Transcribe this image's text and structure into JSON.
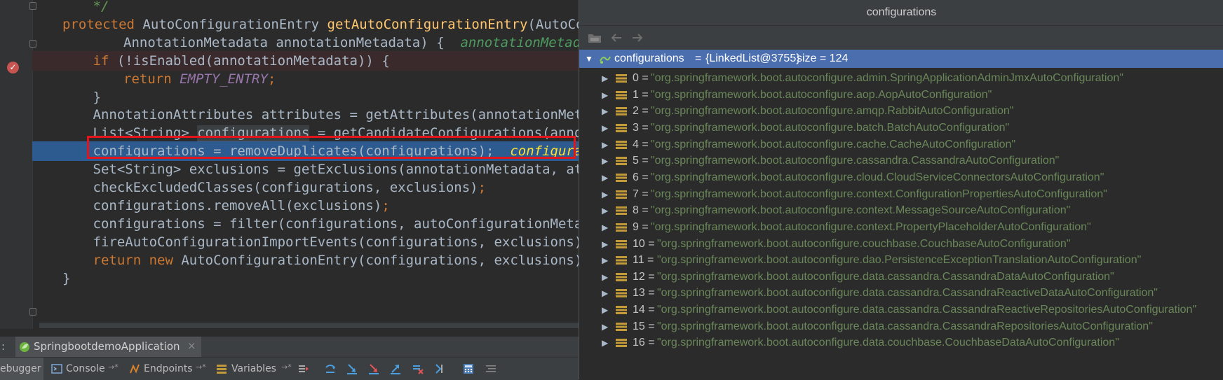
{
  "editor": {
    "lines": [
      {
        "indent": 2,
        "segments": [
          {
            "text": "*/",
            "cls": "cm"
          }
        ]
      },
      {
        "indent": 1,
        "segments": [
          {
            "text": "protected ",
            "cls": "kw"
          },
          {
            "text": "AutoConfigurationEntry ",
            "cls": ""
          },
          {
            "text": "getAutoConfigurationEntry",
            "cls": "fn"
          },
          {
            "text": "(AutoCon",
            "cls": ""
          }
        ]
      },
      {
        "indent": 3,
        "segments": [
          {
            "text": "AnnotationMetadata annotationMetadata) {  ",
            "cls": ""
          },
          {
            "text": "annotationMetadata",
            "cls": "inlay"
          }
        ]
      },
      {
        "indent": 2,
        "segments": [
          {
            "text": "if ",
            "cls": "kw"
          },
          {
            "text": "(!isEnabled(annotationMetadata)) {",
            "cls": ""
          }
        ]
      },
      {
        "indent": 3,
        "segments": [
          {
            "text": "return ",
            "cls": "kw"
          },
          {
            "text": "EMPTY_ENTRY",
            "cls": "const"
          },
          {
            "text": ";",
            "cls": "kw"
          }
        ]
      },
      {
        "indent": 2,
        "segments": [
          {
            "text": "}",
            "cls": ""
          }
        ]
      },
      {
        "indent": 2,
        "segments": [
          {
            "text": "AnnotationAttributes attributes = getAttributes(annotationMeta",
            "cls": ""
          }
        ]
      },
      {
        "indent": 2,
        "segments": [
          {
            "text": "List<String> ",
            "cls": ""
          },
          {
            "text": "configurations",
            "cls": "hl-var"
          },
          {
            "text": " = getCandidateConfigurations(annot",
            "cls": ""
          }
        ]
      },
      {
        "indent": 2,
        "segments": [
          {
            "text": "configurations = removeDuplicates(configurations);  ",
            "cls": ""
          },
          {
            "text": "configurat",
            "cls": "inlay-y"
          }
        ]
      },
      {
        "indent": 2,
        "segments": [
          {
            "text": "Set<String> exclusions = getExclusions(annotationMetadata, att",
            "cls": ""
          }
        ]
      },
      {
        "indent": 2,
        "segments": [
          {
            "text": "checkExcludedClasses(configurations, exclusions)",
            "cls": ""
          },
          {
            "text": ";",
            "cls": "kw"
          }
        ]
      },
      {
        "indent": 2,
        "segments": [
          {
            "text": "configurations.removeAll(exclusions)",
            "cls": ""
          },
          {
            "text": ";",
            "cls": "kw"
          }
        ]
      },
      {
        "indent": 2,
        "segments": [
          {
            "text": "configurations = filter(configurations, autoConfigurationMetad",
            "cls": ""
          }
        ]
      },
      {
        "indent": 2,
        "segments": [
          {
            "text": "fireAutoConfigurationImportEvents(configurations, exclusions)",
            "cls": ""
          },
          {
            "text": ";",
            "cls": "kw"
          }
        ]
      },
      {
        "indent": 2,
        "segments": [
          {
            "text": "return new ",
            "cls": "kw"
          },
          {
            "text": "AutoConfigurationEntry(configurations, exclusions)",
            "cls": ""
          },
          {
            "text": ";",
            "cls": "kw"
          }
        ]
      },
      {
        "indent": 1,
        "segments": [
          {
            "text": "}",
            "cls": ""
          }
        ]
      }
    ]
  },
  "run_tab": {
    "prefix": ":",
    "app_name": "SpringbootdemoApplication",
    "close": "×"
  },
  "debug_toolbar": {
    "debugger_label": "ebugger",
    "console_label": "Console",
    "endpoints_label": "Endpoints",
    "variables_label": "Variables",
    "pin_glyph": "→*"
  },
  "popup": {
    "title": "configurations",
    "root": {
      "name": "configurations",
      "value": "{LinkedList@3755}",
      "size_text": "size = 124"
    },
    "items": [
      {
        "index": "0",
        "value": "\"org.springframework.boot.autoconfigure.admin.SpringApplicationAdminJmxAutoConfiguration\""
      },
      {
        "index": "1",
        "value": "\"org.springframework.boot.autoconfigure.aop.AopAutoConfiguration\""
      },
      {
        "index": "2",
        "value": "\"org.springframework.boot.autoconfigure.amqp.RabbitAutoConfiguration\""
      },
      {
        "index": "3",
        "value": "\"org.springframework.boot.autoconfigure.batch.BatchAutoConfiguration\""
      },
      {
        "index": "4",
        "value": "\"org.springframework.boot.autoconfigure.cache.CacheAutoConfiguration\""
      },
      {
        "index": "5",
        "value": "\"org.springframework.boot.autoconfigure.cassandra.CassandraAutoConfiguration\""
      },
      {
        "index": "6",
        "value": "\"org.springframework.boot.autoconfigure.cloud.CloudServiceConnectorsAutoConfiguration\""
      },
      {
        "index": "7",
        "value": "\"org.springframework.boot.autoconfigure.context.ConfigurationPropertiesAutoConfiguration\""
      },
      {
        "index": "8",
        "value": "\"org.springframework.boot.autoconfigure.context.MessageSourceAutoConfiguration\""
      },
      {
        "index": "9",
        "value": "\"org.springframework.boot.autoconfigure.context.PropertyPlaceholderAutoConfiguration\""
      },
      {
        "index": "10",
        "value": "\"org.springframework.boot.autoconfigure.couchbase.CouchbaseAutoConfiguration\""
      },
      {
        "index": "11",
        "value": "\"org.springframework.boot.autoconfigure.dao.PersistenceExceptionTranslationAutoConfiguration\""
      },
      {
        "index": "12",
        "value": "\"org.springframework.boot.autoconfigure.data.cassandra.CassandraDataAutoConfiguration\""
      },
      {
        "index": "13",
        "value": "\"org.springframework.boot.autoconfigure.data.cassandra.CassandraReactiveDataAutoConfiguration\""
      },
      {
        "index": "14",
        "value": "\"org.springframework.boot.autoconfigure.data.cassandra.CassandraReactiveRepositoriesAutoConfiguration\""
      },
      {
        "index": "15",
        "value": "\"org.springframework.boot.autoconfigure.data.cassandra.CassandraRepositoriesAutoConfiguration\""
      },
      {
        "index": "16",
        "value": "\"org.springframework.boot.autoconfigure.data.couchbase.CouchbaseDataAutoConfiguration\""
      }
    ]
  },
  "colors": {
    "editor_bg": "#2b2b2b",
    "exec_line": "#2d5b8f",
    "breakpoint_line": "#3b2a2b",
    "highlight_box": "#e3141c",
    "tree_selection": "#4b6eaf",
    "string_value": "#6a8759"
  },
  "icons": [
    "breakpoint-icon",
    "fold-marker-icon",
    "spring-app-icon",
    "console-icon",
    "endpoints-icon",
    "variables-icon",
    "step-over-icon",
    "step-into-icon",
    "step-out-icon",
    "evaluate-icon",
    "watch-icon",
    "list-icon",
    "back-icon",
    "forward-icon",
    "folder-icon"
  ]
}
